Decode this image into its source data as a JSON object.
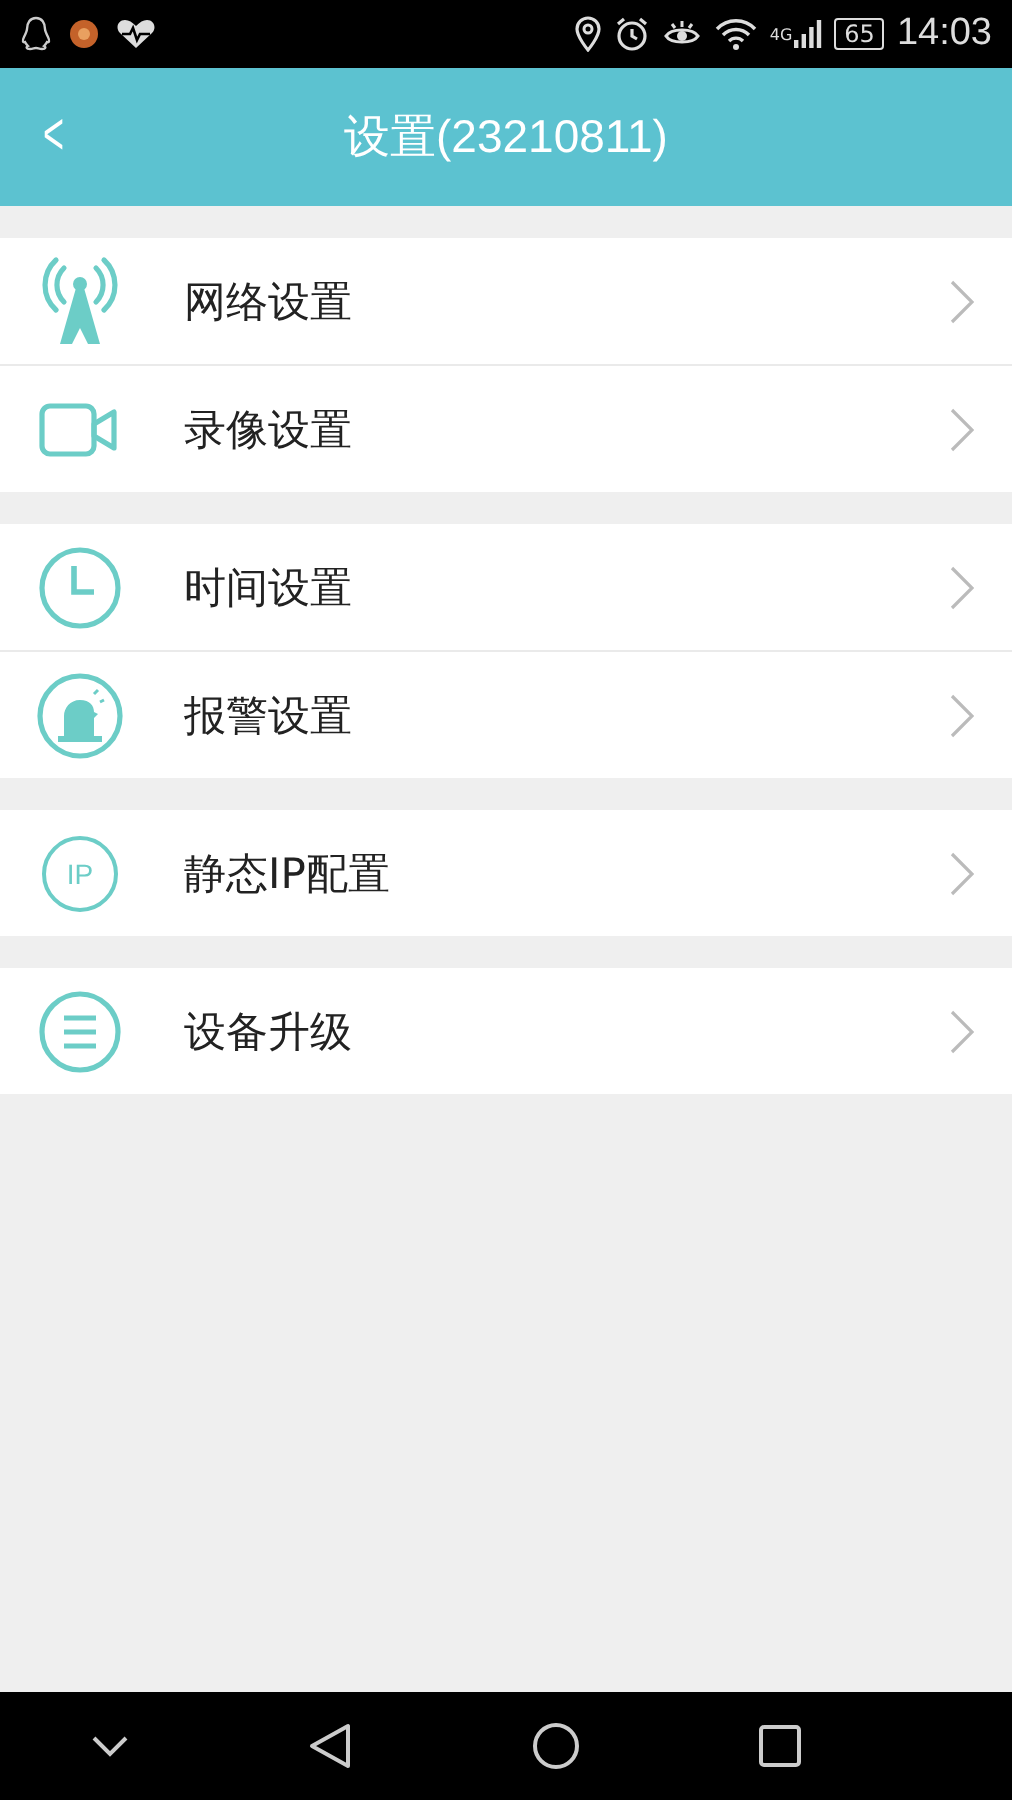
{
  "status_bar": {
    "network": "4G",
    "battery": "65",
    "time": "14:03"
  },
  "header": {
    "back": "<",
    "title": "设置(23210811)"
  },
  "groups": [
    {
      "items": [
        {
          "label": "网络设置"
        },
        {
          "label": "录像设置"
        }
      ]
    },
    {
      "items": [
        {
          "label": "时间设置"
        },
        {
          "label": "报警设置"
        }
      ]
    },
    {
      "items": [
        {
          "icon_text": "IP",
          "label": "静态IP配置"
        }
      ]
    },
    {
      "items": [
        {
          "label": "设备升级"
        }
      ]
    }
  ]
}
